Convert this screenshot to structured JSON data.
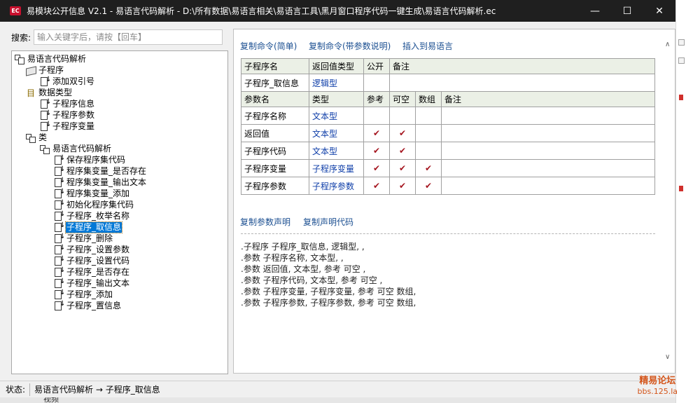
{
  "window": {
    "title": "易模块公开信息 V2.1 - 易语言代码解析 - D:\\所有数据\\易语言相关\\易语言工具\\黑月窗口程序代码一键生成\\易语言代码解析.ec",
    "icon_text": "EC",
    "minimize_glyph": "—",
    "maximize_glyph": "☐",
    "close_glyph": "✕"
  },
  "search": {
    "label": "搜索:",
    "placeholder": "输入关键字后，请按【回车】"
  },
  "tree": {
    "root": "易语言代码解析",
    "subprograms_group": "子程序",
    "subprograms": [
      "添加双引号"
    ],
    "datatypes_group": "数据类型",
    "datatypes": [
      "子程序信息",
      "子程序参数",
      "子程序变量"
    ],
    "class_group": "类",
    "class_name": "易语言代码解析",
    "methods": [
      "保存程序集代码",
      "程序集变量_是否存在",
      "程序集变量_输出文本",
      "程序集变量_添加",
      "初始化程序集代码",
      "子程序_枚举名称",
      "子程序_取信息",
      "子程序_删除",
      "子程序_设置参数",
      "子程序_设置代码",
      "子程序_是否存在",
      "子程序_输出文本",
      "子程序_添加",
      "子程序_置信息"
    ],
    "selected": "子程序_取信息"
  },
  "detail": {
    "top_links": [
      "复制命令(简单)",
      "复制命令(带参数说明)",
      "插入到易语言"
    ],
    "header1": [
      "子程序名",
      "返回值类型",
      "公开",
      "备注"
    ],
    "sub": {
      "name": "子程序_取信息",
      "return_type": "逻辑型",
      "public": "",
      "note": ""
    },
    "header2": [
      "参数名",
      "类型",
      "参考",
      "可空",
      "数组",
      "备注"
    ],
    "params": [
      {
        "name": "子程序名称",
        "type": "文本型",
        "ref": "",
        "nullable": "",
        "array": "",
        "note": ""
      },
      {
        "name": "返回值",
        "type": "文本型",
        "ref": "✔",
        "nullable": "✔",
        "array": "",
        "note": ""
      },
      {
        "name": "子程序代码",
        "type": "文本型",
        "ref": "✔",
        "nullable": "✔",
        "array": "",
        "note": ""
      },
      {
        "name": "子程序变量",
        "type": "子程序变量",
        "ref": "✔",
        "nullable": "✔",
        "array": "✔",
        "note": ""
      },
      {
        "name": "子程序参数",
        "type": "子程序参数",
        "ref": "✔",
        "nullable": "✔",
        "array": "✔",
        "note": ""
      }
    ],
    "bottom_links": [
      "复制参数声明",
      "复制声明代码"
    ],
    "code_lines": [
      ".子程序 子程序_取信息, 逻辑型, ,",
      ".参数 子程序名称, 文本型, ,",
      ".参数 返回值, 文本型, 参考 可空 ,",
      ".参数 子程序代码, 文本型, 参考 可空 ,",
      ".参数 子程序变量, 子程序变量, 参考 可空 数组,",
      ".参数 子程序参数, 子程序参数, 参考 可空 数组,"
    ],
    "scroll_up": "∧",
    "scroll_down": "∨"
  },
  "status": {
    "label": "状态:",
    "text": "易语言代码解析 → 子程序_取信息"
  },
  "watermark": {
    "line1": "精易论坛",
    "line2": "bbs.125.la"
  },
  "background_text": "视频",
  "colors": {
    "titlebar": "#1f1f1f",
    "selection": "#0078d7",
    "link": "#1b4f91",
    "type_link": "#0d3da8",
    "check": "#a51620",
    "header_bg": "#ebf0e6"
  }
}
